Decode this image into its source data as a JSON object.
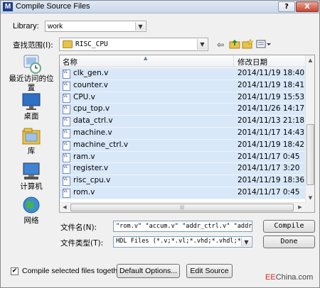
{
  "window": {
    "title": "Compile Source Files",
    "app_icon": "M",
    "help_glyph": "?",
    "close_glyph": "X"
  },
  "library": {
    "label": "Library:",
    "value": "work"
  },
  "lookin": {
    "label": "查找范围(I):",
    "value": "RISC_CPU"
  },
  "toolbar_icons": [
    "back-icon",
    "up-folder-icon",
    "new-folder-icon",
    "view-menu-icon"
  ],
  "places": [
    {
      "name": "recent-places",
      "label": "最近访问的位置"
    },
    {
      "name": "desktop",
      "label": "桌面"
    },
    {
      "name": "libraries",
      "label": "库"
    },
    {
      "name": "computer",
      "label": "计算机"
    },
    {
      "name": "network",
      "label": "网络"
    }
  ],
  "columns": {
    "name": "名称",
    "date": "修改日期"
  },
  "files": [
    {
      "name": "clk_gen.v",
      "date": "2014/11/19 18:40"
    },
    {
      "name": "counter.v",
      "date": "2014/11/19 18:41"
    },
    {
      "name": "CPU.v",
      "date": "2014/11/19 15:53"
    },
    {
      "name": "cpu_top.v",
      "date": "2014/11/26 14:17"
    },
    {
      "name": "data_ctrl.v",
      "date": "2014/11/13 21:18"
    },
    {
      "name": "machine.v",
      "date": "2014/11/17 14:43"
    },
    {
      "name": "machine_ctrl.v",
      "date": "2014/11/19 18:42"
    },
    {
      "name": "ram.v",
      "date": "2014/11/17 0:45"
    },
    {
      "name": "register.v",
      "date": "2014/11/17 3:20"
    },
    {
      "name": "risc_cpu.v",
      "date": "2014/11/19 18:36"
    },
    {
      "name": "rom.v",
      "date": "2014/11/17 0:45"
    }
  ],
  "file_icon_text": "VL",
  "filename": {
    "label": "文件名(N):",
    "value": "\"rom.v\" \"accum.v\" \"addr_ctrl.v\" \"addr_"
  },
  "filetype": {
    "label": "文件类型(T):",
    "value": "HDL Files (*.v;*.vl;*.vhd;*.vhdl;*.vh"
  },
  "buttons": {
    "compile": "Compile",
    "done": "Done",
    "default_options": "Default Options...",
    "edit_source": "Edit Source"
  },
  "compile_together": {
    "label": "Compile selected files together",
    "checked": true,
    "check_glyph": "✔"
  },
  "watermark": {
    "prefix": "EE",
    "main": "China.com"
  },
  "colors": {
    "selection": "#d9e8f8",
    "titlebar": "#dfe9f5"
  }
}
